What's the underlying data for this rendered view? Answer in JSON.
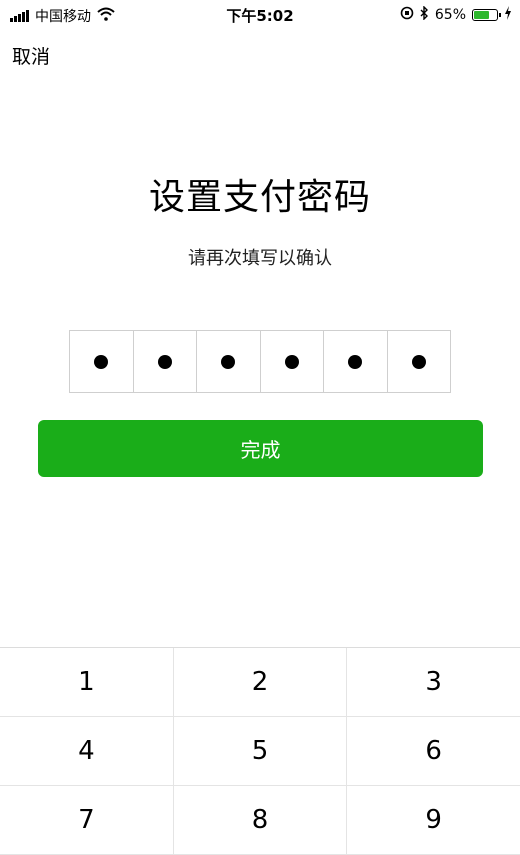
{
  "status_bar": {
    "carrier": "中国移动",
    "time": "下午5:02",
    "battery": "65%",
    "battery_level": 0.65,
    "icons": [
      "signal-icon",
      "wifi-icon",
      "orientation-lock-icon",
      "bluetooth-icon",
      "battery-icon",
      "charging-icon"
    ]
  },
  "nav": {
    "cancel_label": "取消"
  },
  "main": {
    "title": "设置支付密码",
    "subtitle": "请再次填写以确认",
    "pin_length": 6,
    "pin_filled": 6,
    "done_label": "完成",
    "done_color": "#1aad19"
  },
  "keypad": {
    "rows": [
      [
        "1",
        "2",
        "3"
      ],
      [
        "4",
        "5",
        "6"
      ],
      [
        "7",
        "8",
        "9"
      ]
    ]
  }
}
